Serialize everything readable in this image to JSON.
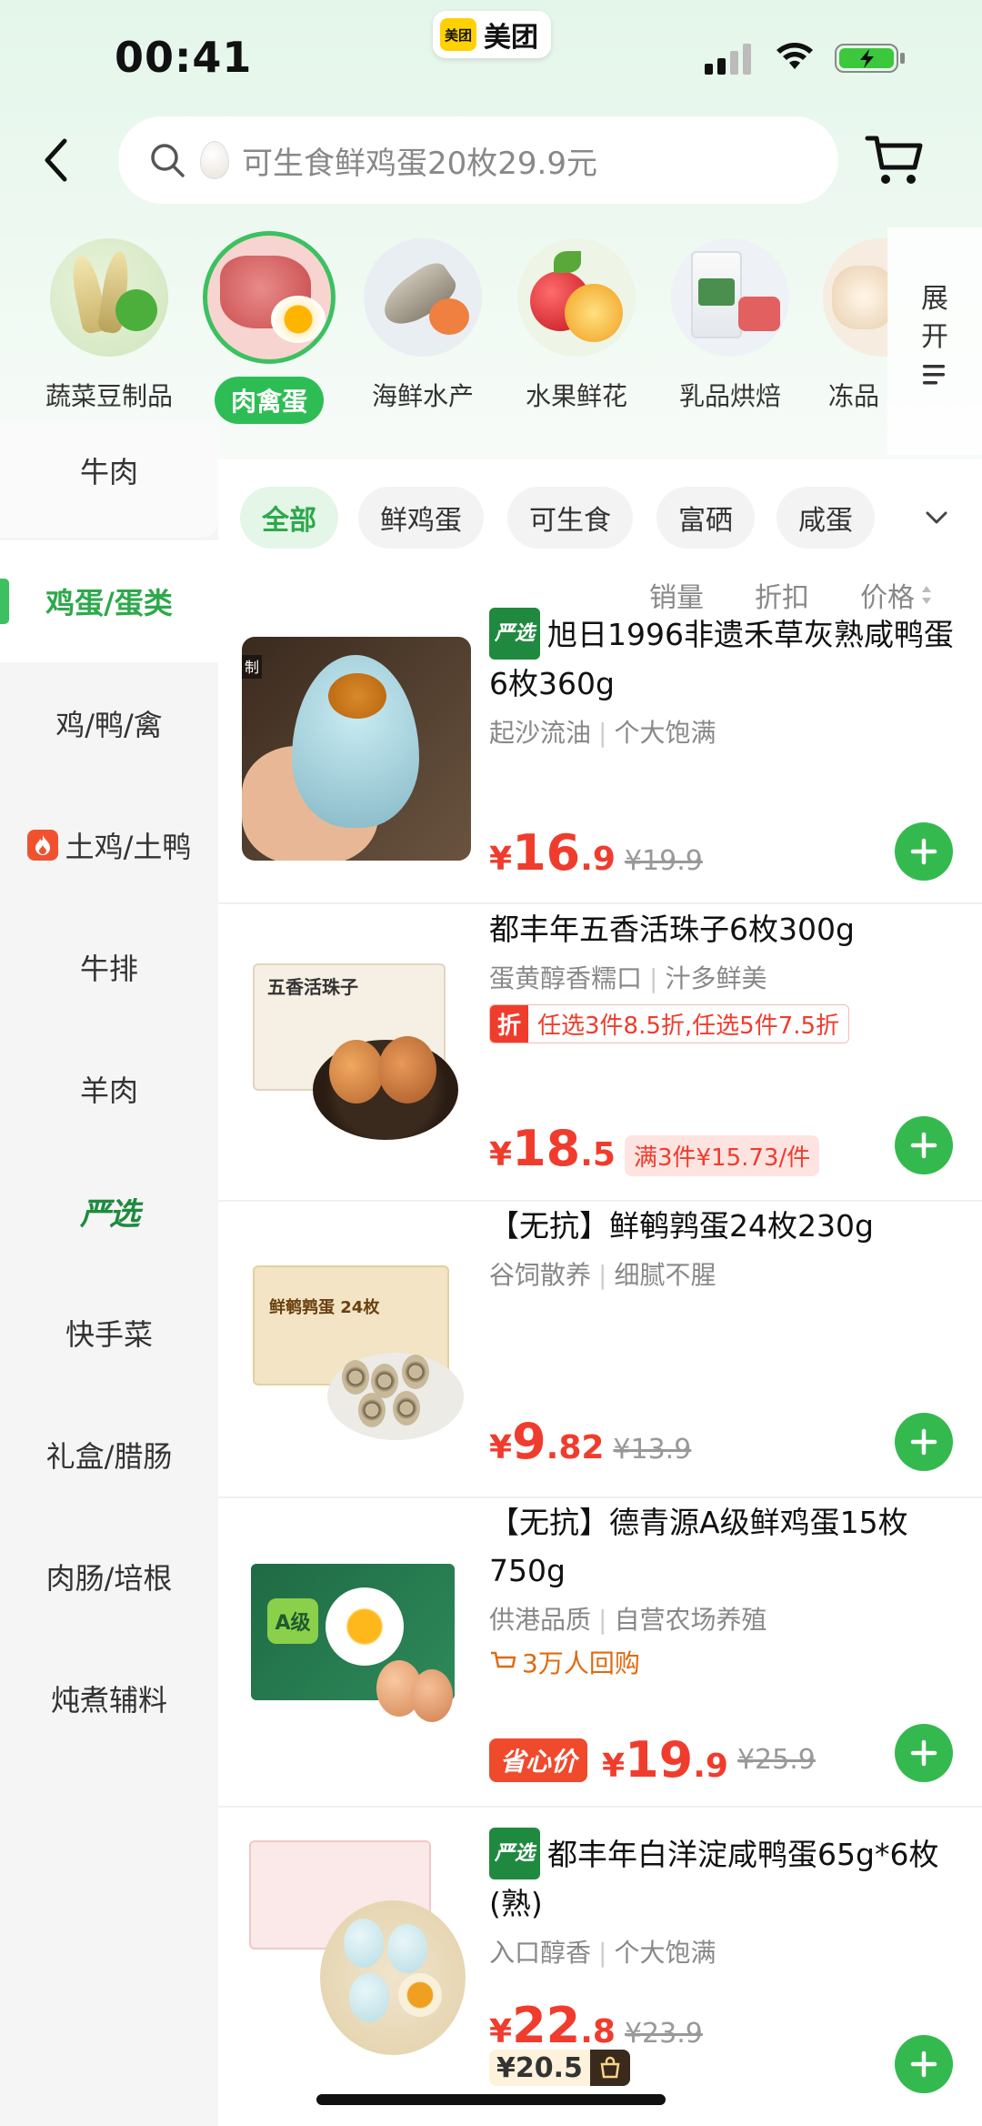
{
  "status_bar": {
    "time": "00:41",
    "app_logo_text": "美团",
    "app_name": "美团"
  },
  "search": {
    "placeholder": "可生食鲜鸡蛋20枚29.9元"
  },
  "categories": [
    {
      "label": "蔬菜豆制品"
    },
    {
      "label": "肉禽蛋",
      "active": true
    },
    {
      "label": "海鲜水产"
    },
    {
      "label": "水果鲜花"
    },
    {
      "label": "乳品烘焙"
    },
    {
      "label": "冻品"
    }
  ],
  "expand": {
    "line1": "展",
    "line2": "开"
  },
  "sidebar": {
    "items": [
      {
        "label": "牛肉"
      },
      {
        "label": "鸡蛋/蛋类",
        "active": true
      },
      {
        "label": "鸡/鸭/禽"
      },
      {
        "label": "土鸡/土鸭"
      },
      {
        "label": "牛排"
      },
      {
        "label": "羊肉"
      },
      {
        "label": "严选"
      },
      {
        "label": "快手菜"
      },
      {
        "label": "礼盒/腊肠"
      },
      {
        "label": "肉肠/培根"
      },
      {
        "label": "炖煮辅料"
      }
    ]
  },
  "filters": [
    "全部",
    "鲜鸡蛋",
    "可生食",
    "富硒",
    "咸蛋"
  ],
  "sort": {
    "sales": "销量",
    "discount": "折扣",
    "price": "价格"
  },
  "image_tags": {
    "p1": "制",
    "p2": "五香活珠子",
    "p3": "鲜鹌鹑蛋 24枚",
    "p4": "A级"
  },
  "products": [
    {
      "tag": "严选",
      "title": "旭日1996非遗禾草灰熟咸鸭蛋6枚360g",
      "sub1": "起沙流油",
      "sub2": "个大饱满",
      "yen": "¥",
      "price_int": "16",
      "price_dec": ".9",
      "orig": "¥19.9"
    },
    {
      "title": "都丰年五香活珠子6枚300g",
      "sub1": "蛋黄醇香糯口",
      "sub2": "汁多鲜美",
      "promo_icon": "折",
      "promo_text": "任选3件8.5折,任选5件7.5折",
      "yen": "¥",
      "price_int": "18",
      "price_dec": ".5",
      "unit_badge": "满3件¥15.73/件"
    },
    {
      "title": "【无抗】鲜鹌鹑蛋24枚230g",
      "sub1": "谷饲散养",
      "sub2": "细腻不腥",
      "yen": "¥",
      "price_int": "9",
      "price_dec": ".82",
      "orig": "¥13.9"
    },
    {
      "title": "【无抗】德青源A级鲜鸡蛋15枚750g",
      "sub1": "供港品质",
      "sub2": "自营农场养殖",
      "repurchase": "3万人回购",
      "badge": "省心价",
      "yen": "¥",
      "price_int": "19",
      "price_dec": ".9",
      "orig": "¥25.9"
    },
    {
      "tag": "严选",
      "title": "都丰年白洋淀咸鸭蛋65g*6枚(熟)",
      "sub1": "入口醇香",
      "sub2": "个大饱满",
      "yen": "¥",
      "price_int": "22",
      "price_dec": ".8",
      "orig": "¥23.9",
      "member_price": "¥20.5"
    }
  ],
  "colors": {
    "accent": "#34b94f",
    "price": "#f03c2d",
    "brand_yellow": "#ffd100"
  }
}
